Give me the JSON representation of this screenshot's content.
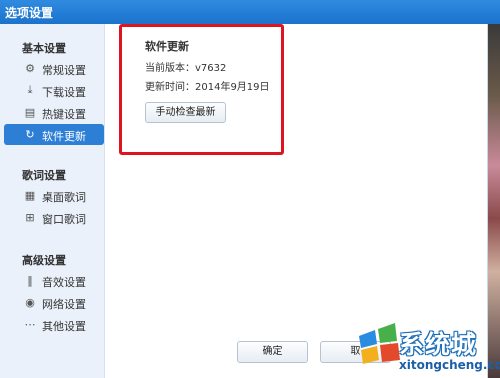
{
  "window": {
    "title": "选项设置"
  },
  "sidebar": {
    "groups": [
      {
        "header": "基本设置",
        "items": [
          {
            "label": "常规设置",
            "icon": "gear-icon"
          },
          {
            "label": "下载设置",
            "icon": "download-icon"
          },
          {
            "label": "热键设置",
            "icon": "keyboard-icon"
          },
          {
            "label": "软件更新",
            "icon": "update-icon",
            "active": true
          }
        ]
      },
      {
        "header": "歌词设置",
        "items": [
          {
            "label": "桌面歌词",
            "icon": "desktop-lyrics-icon"
          },
          {
            "label": "窗口歌词",
            "icon": "window-lyrics-icon"
          }
        ]
      },
      {
        "header": "高级设置",
        "items": [
          {
            "label": "音效设置",
            "icon": "equalizer-icon"
          },
          {
            "label": "网络设置",
            "icon": "network-icon"
          },
          {
            "label": "其他设置",
            "icon": "more-icon"
          }
        ]
      }
    ]
  },
  "main": {
    "section_title": "软件更新",
    "current_version_label": "当前版本：",
    "current_version": "v7632",
    "update_time_label": "更新时间：",
    "update_time": "2014年9月19日",
    "check_button": "手动检查最新"
  },
  "footer": {
    "ok_label": "确定",
    "cancel_label": "取"
  },
  "watermark": {
    "brand": "系统城",
    "url": "xitongcheng.com"
  },
  "colors": {
    "titlebar": "#1b73cc",
    "active_item": "#2d7fd6",
    "highlight": "#e0141e"
  }
}
